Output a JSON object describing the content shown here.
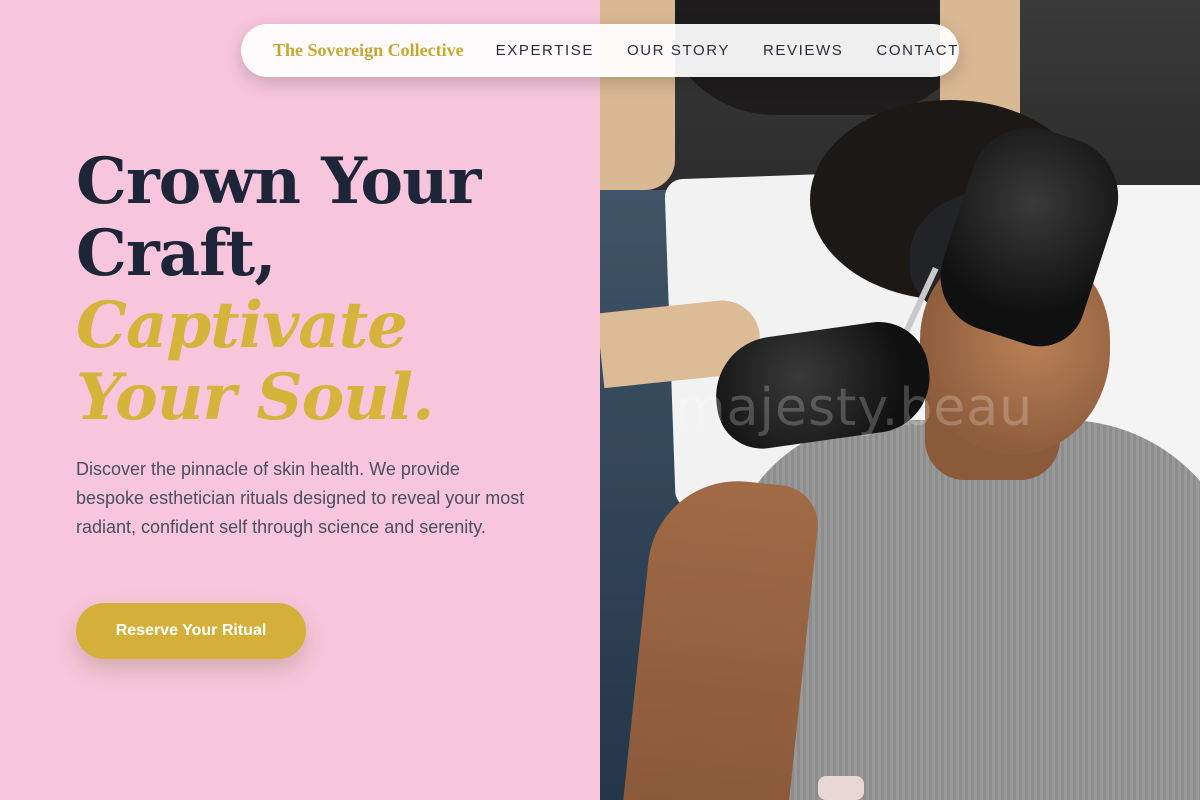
{
  "nav": {
    "brand": "The Sovereign Collective",
    "links": [
      "EXPERTISE",
      "OUR STORY",
      "REVIEWS",
      "CONTACT"
    ]
  },
  "hero": {
    "headline_lines": [
      "Crown Your",
      "Craft,"
    ],
    "headline_accent_lines": [
      "Captivate",
      "Your Soul."
    ],
    "description": "Discover the pinnacle of skin health. We provide bespoke esthetician rituals designed to reveal your most radiant, confident self through science and serenity.",
    "cta_label": "Reserve Your Ritual"
  },
  "photo": {
    "watermark": "majesty.beau"
  },
  "colors": {
    "background_pink": "#f7c6dc",
    "accent_gold": "#d4b03a",
    "text_navy": "#1f2538"
  }
}
